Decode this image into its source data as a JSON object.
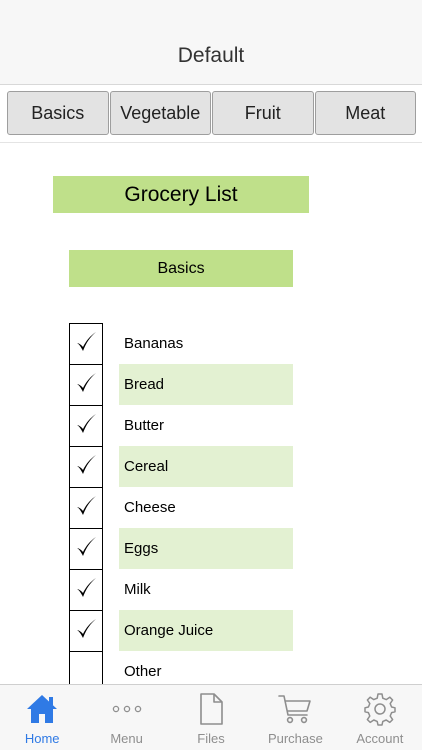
{
  "nav": {
    "title": "Default"
  },
  "categories": [
    {
      "label": "Basics"
    },
    {
      "label": "Vegetable"
    },
    {
      "label": "Fruit"
    },
    {
      "label": "Meat"
    }
  ],
  "list": {
    "title": "Grocery List",
    "section": "Basics",
    "items": [
      {
        "label": "Bananas",
        "checked": true
      },
      {
        "label": "Bread",
        "checked": true
      },
      {
        "label": "Butter",
        "checked": true
      },
      {
        "label": "Cereal",
        "checked": true
      },
      {
        "label": "Cheese",
        "checked": true
      },
      {
        "label": "Eggs",
        "checked": true
      },
      {
        "label": "Milk",
        "checked": true
      },
      {
        "label": "Orange Juice",
        "checked": true
      },
      {
        "label": "Other",
        "checked": false
      }
    ]
  },
  "tab_bar": {
    "items": [
      {
        "label": "Home",
        "icon": "home-icon",
        "active": true
      },
      {
        "label": "Menu",
        "icon": "more-dots-icon",
        "active": false
      },
      {
        "label": "Files",
        "icon": "file-icon",
        "active": false
      },
      {
        "label": "Purchase",
        "icon": "cart-icon",
        "active": false
      },
      {
        "label": "Account",
        "icon": "gear-icon",
        "active": false
      }
    ]
  },
  "colors": {
    "accent_green": "#bfe08a",
    "row_shade": "#e3f1d2",
    "active_blue": "#2f7ae5",
    "inactive_gray": "#8e8e8e"
  }
}
